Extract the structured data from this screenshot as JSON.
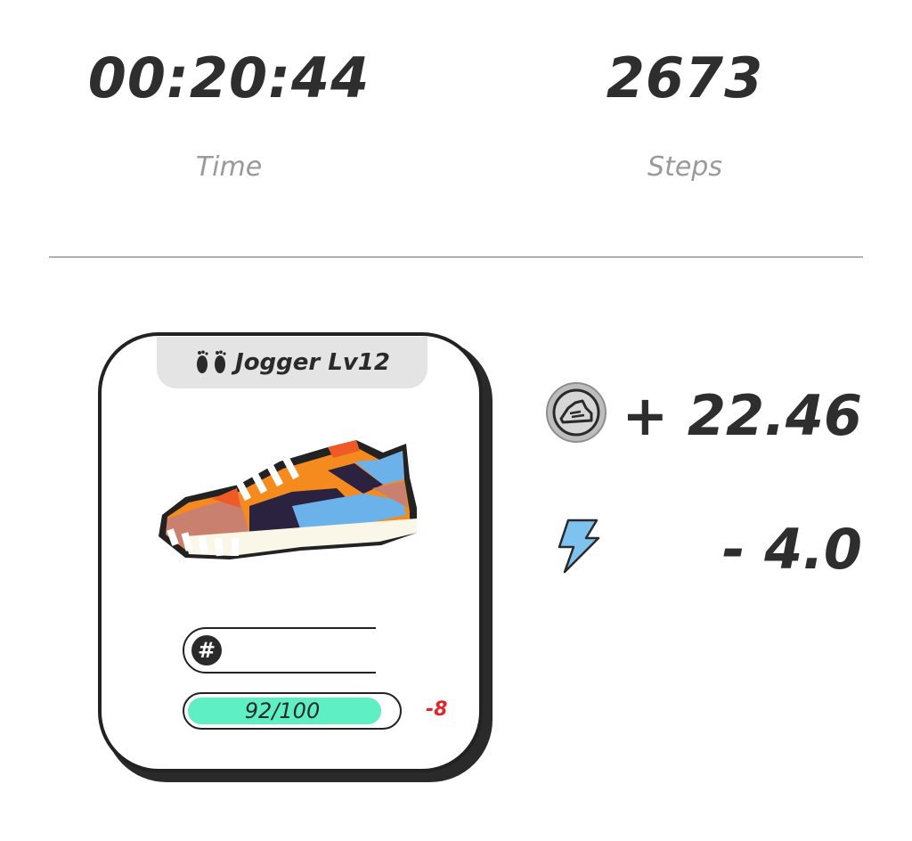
{
  "stats": {
    "time": {
      "value": "00:20:44",
      "label": "Time"
    },
    "steps": {
      "value": "2673",
      "label": "Steps"
    }
  },
  "card": {
    "title": "Jogger Lv12",
    "type_icon": "footprints-icon",
    "image": "sneaker-image",
    "id_symbol": "#",
    "durability": {
      "text": "92/100",
      "current": 92,
      "max": 100,
      "delta": "-8"
    }
  },
  "rewards": {
    "earned": {
      "icon": "sneaker-token-icon",
      "value": "+ 22.46"
    },
    "energy": {
      "icon": "lightning-bolt-icon",
      "value": "- 4.0"
    }
  },
  "colors": {
    "durability_fill": "#5ef0c3",
    "negative": "#e3242b",
    "energy_icon": "#7ec3ef"
  }
}
